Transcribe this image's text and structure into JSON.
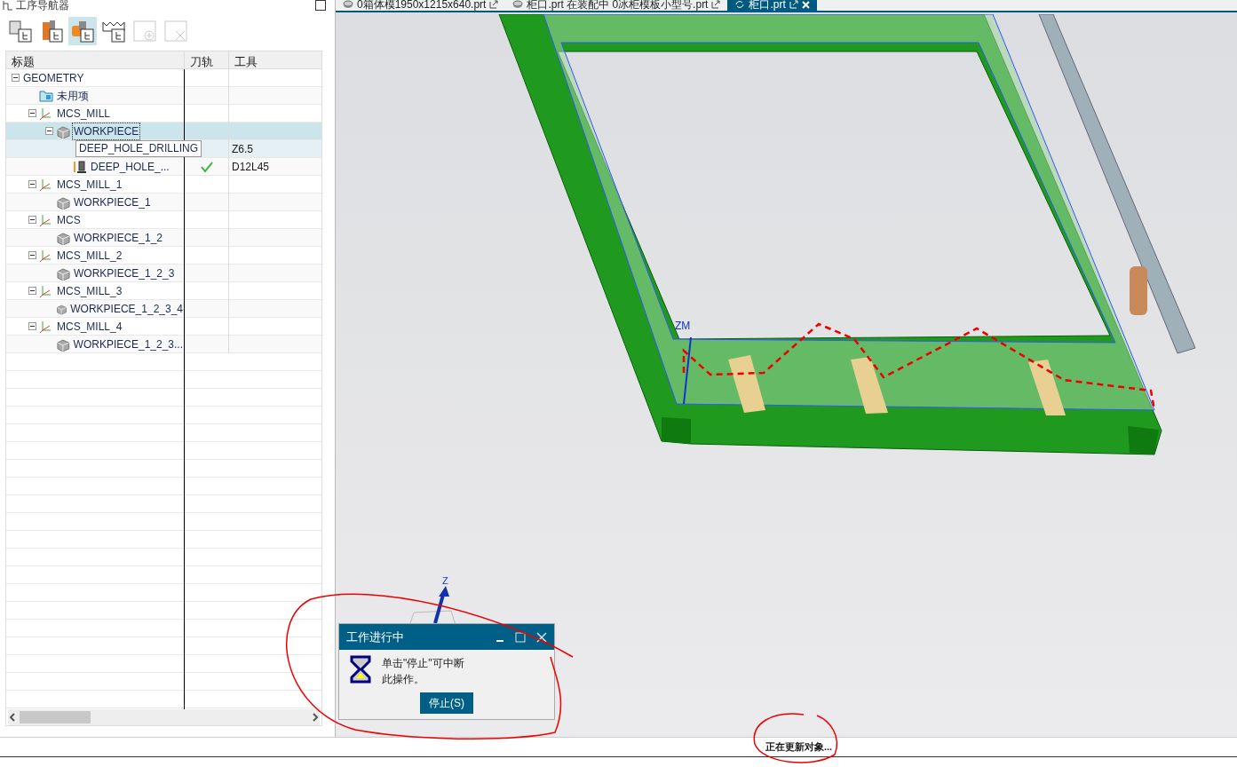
{
  "tabs": [
    {
      "label": "0箱体模1950x1215x640.prt",
      "kind": "part",
      "selected": false
    },
    {
      "label": "柜口.prt 在装配中 0冰柜模板小型号.prt",
      "kind": "part",
      "selected": false
    },
    {
      "label": "柜口.prt",
      "kind": "sync",
      "selected": true
    }
  ],
  "navigator": {
    "title": "工序导航器",
    "toolbar": [
      {
        "kind": "program",
        "selected": false,
        "disabled": false
      },
      {
        "kind": "machine",
        "selected": false,
        "disabled": false
      },
      {
        "kind": "geometry",
        "selected": true,
        "disabled": false
      },
      {
        "kind": "method",
        "selected": false,
        "disabled": false
      },
      {
        "kind": "insert",
        "selected": false,
        "disabled": true
      },
      {
        "kind": "delete",
        "selected": false,
        "disabled": true
      }
    ],
    "columns": [
      "标题",
      "刀轨",
      "工具"
    ],
    "tree": [
      {
        "label": "GEOMETRY",
        "selected": false,
        "expanded": true,
        "children": [
          {
            "label": "未用项",
            "kind": "folder",
            "selected": false
          },
          {
            "label": "MCS_MILL",
            "kind": "mcs",
            "selected": false,
            "expanded": true,
            "children": [
              {
                "label": "WORKPIECE",
                "kind": "workpiece",
                "selected": true,
                "expanded": true,
                "children": [
                  {
                    "label": "DEEP_HOLE_DRILLING",
                    "kind": "operation",
                    "selected": false,
                    "hovered": true,
                    "toolpath": false,
                    "tool": "Z6.5"
                  },
                  {
                    "label": "DEEP_HOLE_...",
                    "kind": "operation",
                    "selected": false,
                    "hovered": false,
                    "toolpath": true,
                    "tool": "D12L45"
                  }
                ]
              }
            ]
          },
          {
            "label": "MCS_MILL_1",
            "kind": "mcs",
            "selected": false,
            "expanded": true,
            "children": [
              {
                "label": "WORKPIECE_1",
                "kind": "workpiece",
                "selected": false
              }
            ]
          },
          {
            "label": "MCS",
            "kind": "mcs",
            "selected": false,
            "expanded": true,
            "children": [
              {
                "label": "WORKPIECE_1_2",
                "kind": "workpiece",
                "selected": false
              }
            ]
          },
          {
            "label": "MCS_MILL_2",
            "kind": "mcs",
            "selected": false,
            "expanded": true,
            "children": [
              {
                "label": "WORKPIECE_1_2_3",
                "kind": "workpiece",
                "selected": false
              }
            ]
          },
          {
            "label": "MCS_MILL_3",
            "kind": "mcs",
            "selected": false,
            "expanded": true,
            "children": [
              {
                "label": "WORKPIECE_1_2_3_4",
                "kind": "workpiece",
                "selected": false
              }
            ]
          },
          {
            "label": "MCS_MILL_4",
            "kind": "mcs",
            "selected": false,
            "expanded": true,
            "children": [
              {
                "label": "WORKPIECE_1_2_3...",
                "kind": "workpiece",
                "selected": false
              }
            ]
          }
        ]
      }
    ]
  },
  "viewport": {
    "labels": [
      {
        "text": "ZM",
        "kind": "mcs"
      },
      {
        "text": "Z",
        "kind": "triad"
      }
    ]
  },
  "dialog": {
    "title": "工作进行中",
    "message": "单击\"停止\"可中断此操作。",
    "button": "停止(S)"
  },
  "status_bar": {
    "text": "正在更新对象..."
  }
}
